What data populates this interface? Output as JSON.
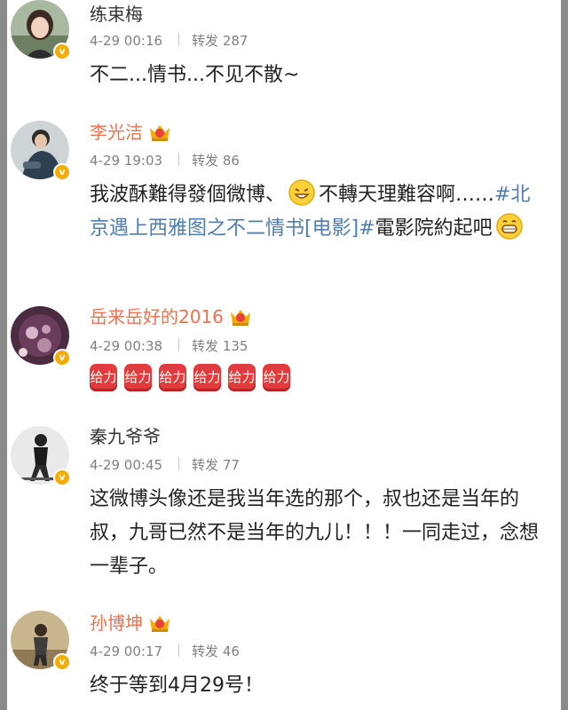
{
  "colors": {
    "vip_name": "#eb7350",
    "topic_link": "#507daf",
    "verified_badge": "#f6ab00",
    "bump_icon": "#e23b3b"
  },
  "comments": [
    {
      "name": "练束梅",
      "name_style": "plain",
      "has_crown": false,
      "verified": true,
      "time": "4-29 00:16",
      "repost_label": "转发",
      "repost_count": "287",
      "text": "不二...情书...不见不散~"
    },
    {
      "name": "李光洁",
      "name_style": "vip",
      "has_crown": true,
      "verified": true,
      "time": "4-29 19:03",
      "repost_label": "转发",
      "repost_count": "86",
      "text_part1": "我波酥難得發個微博、",
      "emoji1": "grinning-emoji",
      "text_part2": "不轉天理難容啊……",
      "topic": "#北京遇上西雅图之不二情书[电影]#",
      "text_part3": "電影院約起吧",
      "emoji2": "big-grin-emoji"
    },
    {
      "name": "岳来岳好的2016",
      "name_style": "vip",
      "has_crown": true,
      "verified": true,
      "time": "4-29 00:38",
      "repost_label": "转发",
      "repost_count": "135",
      "bump_icon_text": "给力",
      "bump_count": 6
    },
    {
      "name": "秦九爷爷",
      "name_style": "plain",
      "has_crown": false,
      "verified": true,
      "time": "4-29 00:45",
      "repost_label": "转发",
      "repost_count": "77",
      "text": "这微博头像还是我当年选的那个，叔也还是当年的叔，九哥已然不是当年的九儿！！！一同走过，念想一辈子。"
    },
    {
      "name": "孙博坤",
      "name_style": "vip",
      "has_crown": true,
      "verified": true,
      "time": "4-29 00:17",
      "repost_label": "转发",
      "repost_count": "46",
      "text": "终于等到4月29号！"
    }
  ]
}
